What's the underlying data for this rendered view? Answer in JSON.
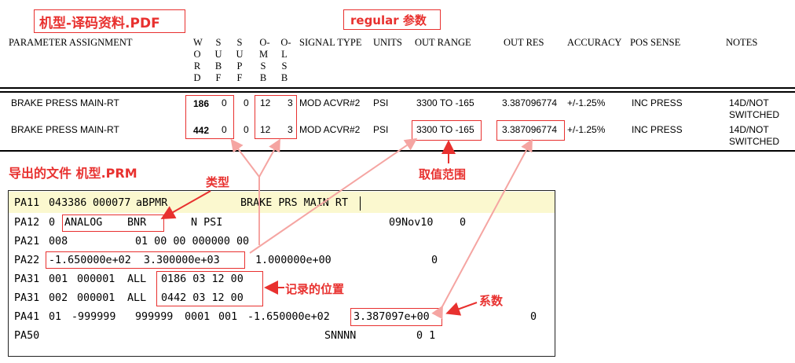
{
  "labels": {
    "pdf_title": "机型-译码资料.PDF",
    "regular_title": "regular 参数",
    "prm_title": "导出的文件  机型.PRM",
    "type_label": "类型",
    "range_label": "取值范围",
    "position_label": "记录的位置",
    "coef_label": "系数"
  },
  "header": {
    "param_assignment": "PARAMETER ASSIGNMENT",
    "word": [
      "W",
      "O",
      "R",
      "D"
    ],
    "subf": [
      "S",
      "U",
      "B",
      "F"
    ],
    "supf": [
      "S",
      "U",
      "P",
      "F"
    ],
    "omsb": [
      "O-",
      "M",
      "S",
      "B"
    ],
    "olsb": [
      "O-",
      "L",
      "S",
      "B"
    ],
    "signal_type": "SIGNAL TYPE",
    "units": "UNITS",
    "out_range": "OUT RANGE",
    "out_res": "OUT RES",
    "accuracy": "ACCURACY",
    "pos_sense": "POS SENSE",
    "notes": "NOTES"
  },
  "rows": [
    {
      "name": "BRAKE PRESS MAIN-RT",
      "word": "186",
      "subf": "0",
      "supf": "0",
      "omsb": "12",
      "olsb": "3",
      "signal": "MOD ACVR#2",
      "units": "PSI",
      "range": "3300 TO -165",
      "res": "3.387096774",
      "accuracy": "+/-1.25%",
      "pos": "INC PRESS",
      "notes1": "14D/NOT",
      "notes2": "SWITCHED"
    },
    {
      "name": "BRAKE PRESS MAIN-RT",
      "word": "442",
      "subf": "0",
      "supf": "0",
      "omsb": "12",
      "olsb": "3",
      "signal": "MOD ACVR#2",
      "units": "PSI",
      "range": "3300 TO -165",
      "res": "3.387096774",
      "accuracy": "+/-1.25%",
      "pos": "INC PRESS",
      "notes1": "14D/NOT",
      "notes2": "SWITCHED"
    }
  ],
  "prm": {
    "pa11": {
      "code": "PA11",
      "a": "043386",
      "b": "000077",
      "c": "aBPMR",
      "d": "BRAKE PRS MAIN RT"
    },
    "pa12": {
      "code": "PA12",
      "a": "0",
      "type": "ANALOG",
      "enc": "BNR",
      "d": "N PSI",
      "date": "09Nov10",
      "z": "0"
    },
    "pa21": {
      "code": "PA21",
      "a": "008",
      "rest": "01 00 00 000000 00"
    },
    "pa22": {
      "code": "PA22",
      "range": "-1.650000e+02  3.300000e+03",
      "b": "1.000000e+00",
      "z": "0"
    },
    "pa31a": {
      "code": "PA31",
      "a": "001",
      "b": "000001",
      "c": "ALL",
      "pos": "0186 03 12 00"
    },
    "pa31b": {
      "code": "PA31",
      "a": "002",
      "b": "000001",
      "c": "ALL",
      "pos": "0442 03 12 00"
    },
    "pa41": {
      "code": "PA41",
      "a": "01",
      "b": "-999999",
      "c": "999999",
      "d": "0001",
      "e": "001",
      "f": "-1.650000e+02",
      "coef": "3.387097e+00",
      "z": "0"
    },
    "pa50": {
      "code": "PA50",
      "a": "SNNNN",
      "b": "0 1"
    }
  }
}
